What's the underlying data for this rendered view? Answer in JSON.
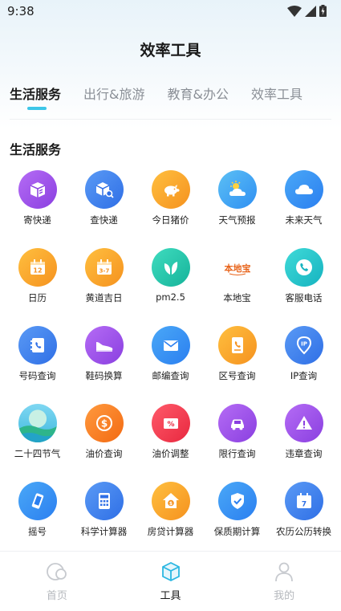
{
  "status_bar": {
    "time": "9:38"
  },
  "header": {
    "title": "效率工具"
  },
  "tabs": [
    {
      "label": "生活服务",
      "active": true
    },
    {
      "label": "出行&旅游",
      "active": false
    },
    {
      "label": "教育&办公",
      "active": false
    },
    {
      "label": "效率工具",
      "active": false
    }
  ],
  "section": {
    "title": "生活服务"
  },
  "tools": [
    {
      "label": "寄快递",
      "icon": "package-send-icon",
      "color": "#9b4fe8"
    },
    {
      "label": "查快递",
      "icon": "package-search-icon",
      "color": "#3b7ff0"
    },
    {
      "label": "今日猪价",
      "icon": "pig-icon",
      "color": "#f5a623"
    },
    {
      "label": "天气预报",
      "icon": "sun-cloud-icon",
      "color": "#3aa7f0"
    },
    {
      "label": "未来天气",
      "icon": "cloud-icon",
      "color": "#2f8ff2"
    },
    {
      "label": "日历",
      "icon": "calendar-icon",
      "color": "#f5a623"
    },
    {
      "label": "黄道吉日",
      "icon": "calendar-icon",
      "color": "#f5a623"
    },
    {
      "label": "pm2.5",
      "icon": "leaf-icon",
      "color": "#22c3a8"
    },
    {
      "label": "本地宝",
      "icon": "bendibao-logo",
      "color": "#ffffff"
    },
    {
      "label": "客服电话",
      "icon": "phone-icon",
      "color": "#22c3c9"
    },
    {
      "label": "号码查询",
      "icon": "phone-book-icon",
      "color": "#3b7ff0"
    },
    {
      "label": "鞋码换算",
      "icon": "shoe-icon",
      "color": "#9b4fe8"
    },
    {
      "label": "邮编查询",
      "icon": "mail-icon",
      "color": "#2f9cf0"
    },
    {
      "label": "区号查询",
      "icon": "phone-card-icon",
      "color": "#f5a623"
    },
    {
      "label": "IP查询",
      "icon": "ip-pin-icon",
      "color": "#3b7ff0"
    },
    {
      "label": "二十四节气",
      "icon": "landscape-icon",
      "color": "#56c6e6"
    },
    {
      "label": "油价查询",
      "icon": "dollar-icon",
      "color": "#f57c1f"
    },
    {
      "label": "油价调整",
      "icon": "percent-icon",
      "color": "#f0384f"
    },
    {
      "label": "限行查询",
      "icon": "car-icon",
      "color": "#9b4fe8"
    },
    {
      "label": "违章查询",
      "icon": "warning-icon",
      "color": "#9b4fe8"
    },
    {
      "label": "摇号",
      "icon": "phone-shake-icon",
      "color": "#2f9cf0"
    },
    {
      "label": "科学计算器",
      "icon": "calculator-icon",
      "color": "#3b7ff0"
    },
    {
      "label": "房贷计算器",
      "icon": "house-money-icon",
      "color": "#f5a623"
    },
    {
      "label": "保质期计算",
      "icon": "shield-check-icon",
      "color": "#2f9cf0"
    },
    {
      "label": "农历公历转换",
      "icon": "calendar-7-icon",
      "color": "#3b7ff0"
    }
  ],
  "icon_text": {
    "cal12": "12",
    "cal37": "3-7",
    "cal7": "7",
    "ip": "IP",
    "dollar": "$",
    "percent": "%",
    "bendibao": "本地宝"
  },
  "bottom_nav": [
    {
      "label": "首页",
      "icon": "home-icon",
      "active": false
    },
    {
      "label": "工具",
      "icon": "toolbox-icon",
      "active": true
    },
    {
      "label": "我的",
      "icon": "user-icon",
      "active": false
    }
  ]
}
